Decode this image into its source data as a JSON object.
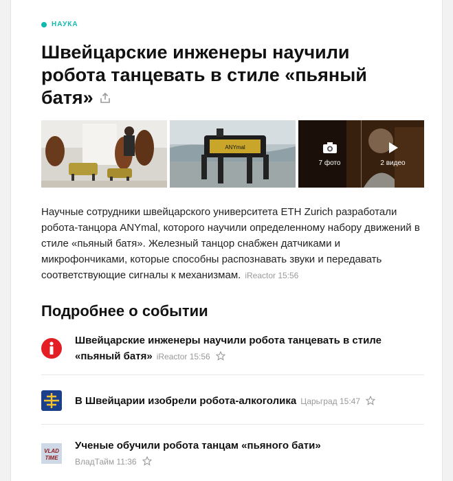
{
  "category": {
    "label": "НАУКА",
    "color": "#11b9b0"
  },
  "article": {
    "title": "Швейцарские инженеры научили робота танцевать в стиле «пьяный батя»",
    "lead": "Научные сотрудники швейцарского университета ETH Zurich разработали робота-танцора ANYmal, которого научили определенному набору движений в стиле «пьяный батя». Железный танцор снабжен датчиками и микрофончиками, которые способны распознавать звуки и передавать соответствующие сигналы к механизмам.",
    "source": "iReactor 15:56",
    "share_icon": "share-icon"
  },
  "gallery": {
    "photos_count": "7 фото",
    "videos_count": "2 видео",
    "robot_logo_text": "ANYmal"
  },
  "related": {
    "title": "Подробнее о событии",
    "items": [
      {
        "title": "Швейцарские инженеры научили робота танцевать в стиле «пьяный батя»",
        "source": "iReactor 15:56",
        "icon": "ireactor-logo-icon",
        "icon_color": "#e31e24"
      },
      {
        "title": "В Швейцарии изобрели робота-алкоголика",
        "source": "Царьград 15:47",
        "icon": "tsargrad-logo-icon",
        "icon_color": "#1c3f8c"
      },
      {
        "title": "Ученые обучили робота танцам «пьяного бати»",
        "source": "ВладТайм 11:36",
        "icon": "vladtime-logo-icon",
        "logo_text_top": "VLAD",
        "logo_text_bottom": "TIME"
      }
    ]
  }
}
